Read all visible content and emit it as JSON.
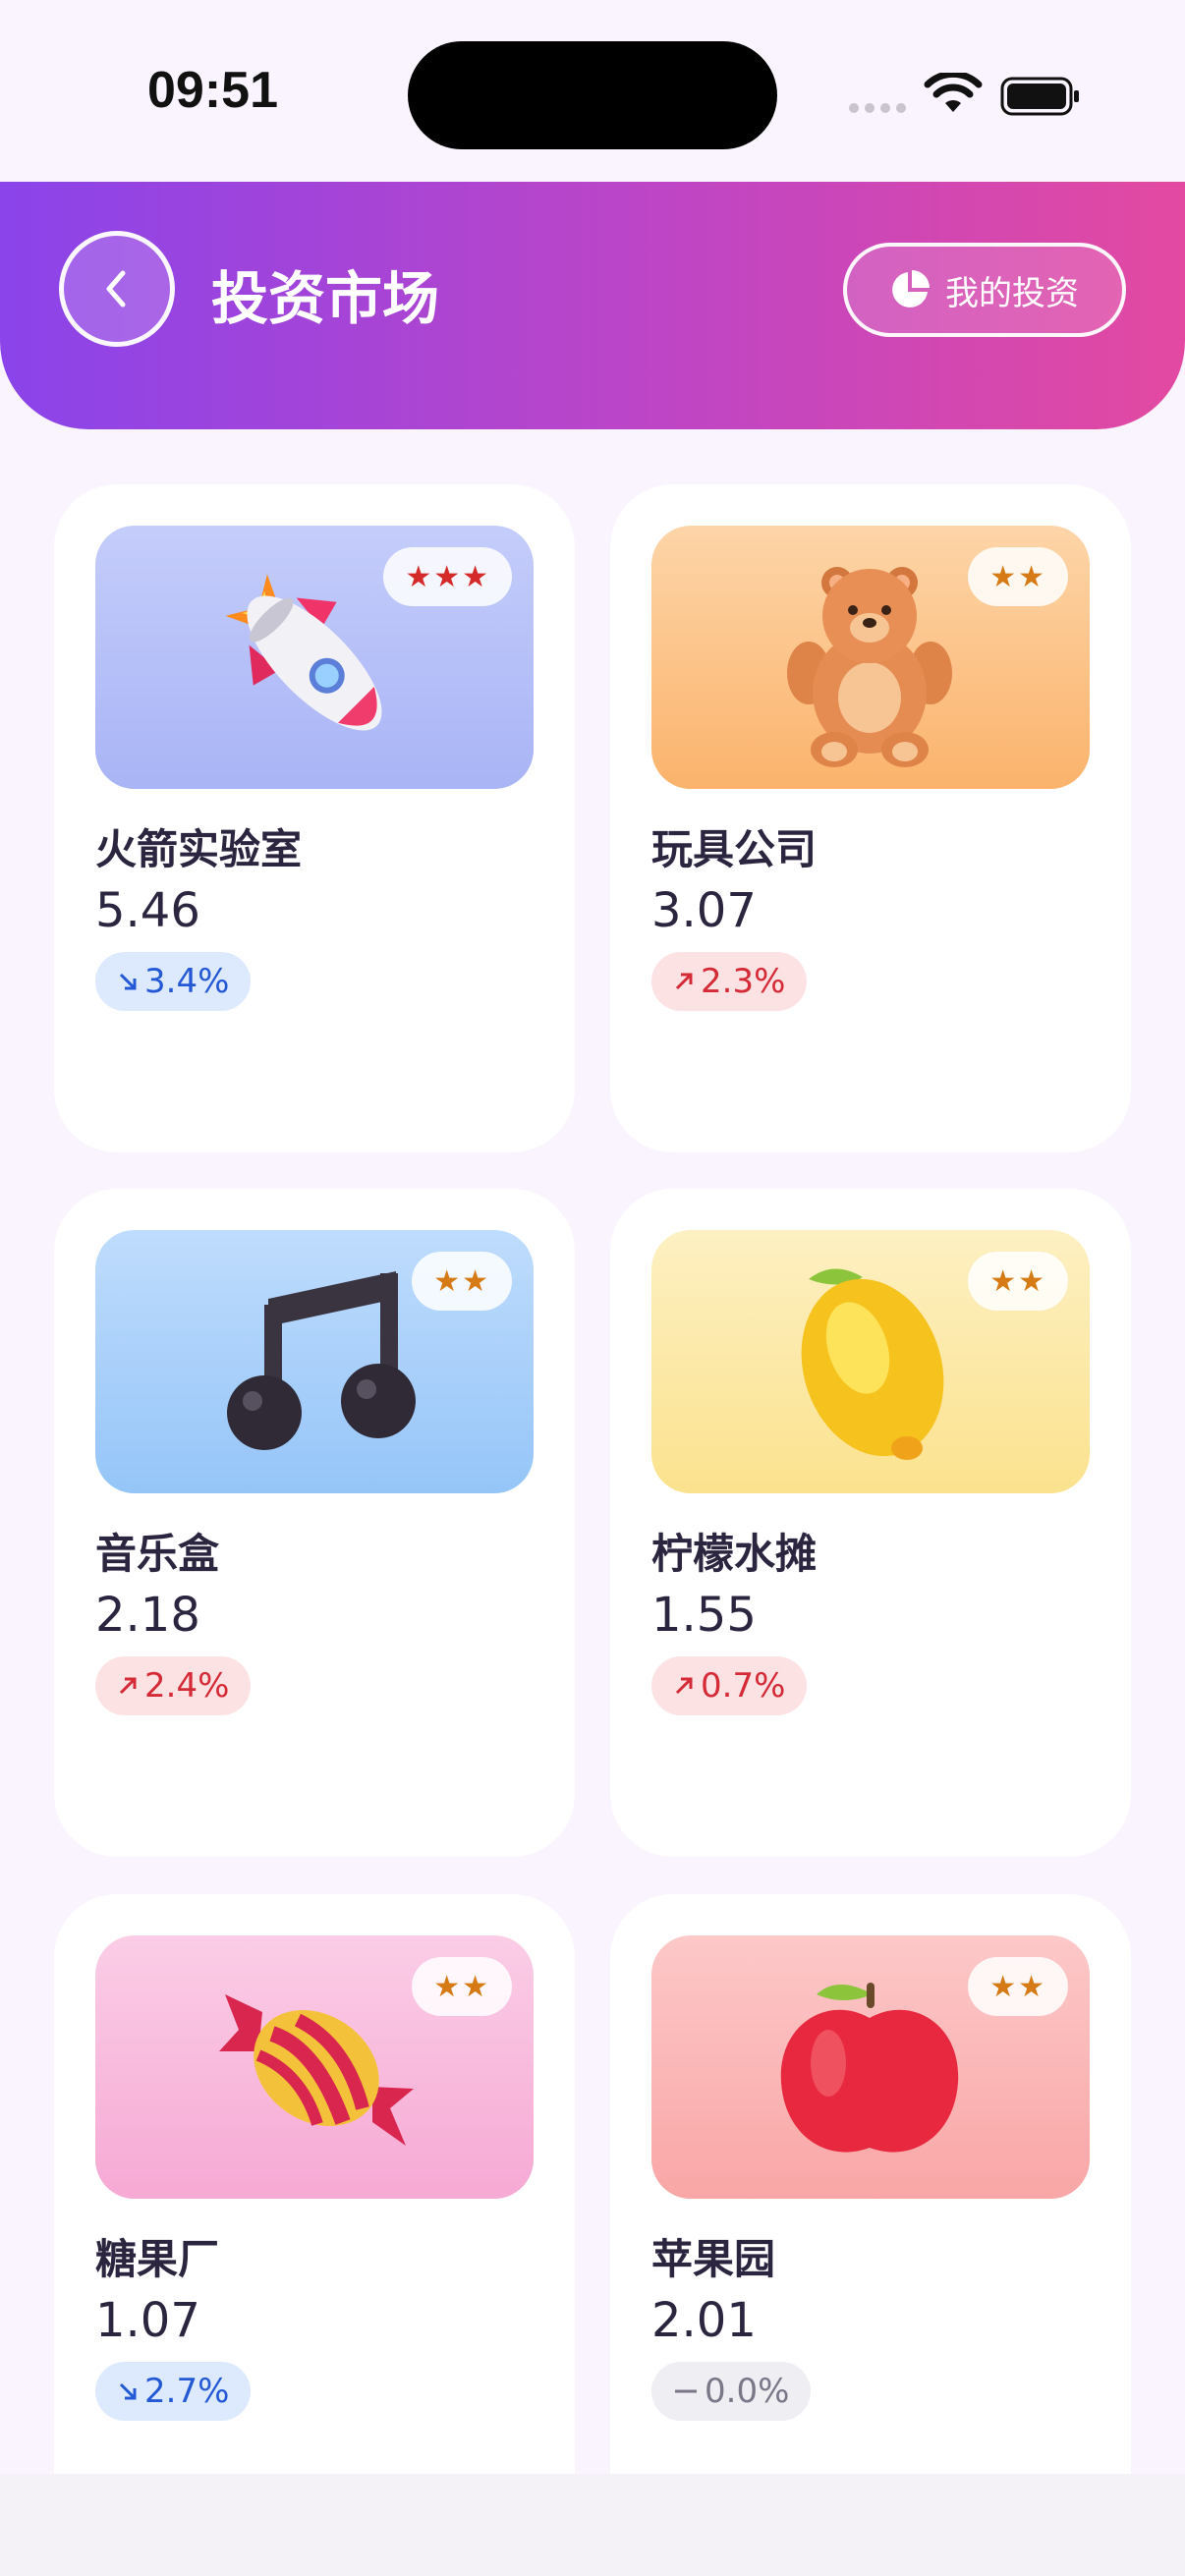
{
  "status_bar": {
    "time": "09:51"
  },
  "header": {
    "title": "投资市场",
    "my_investment_label": "我的投资"
  },
  "cards": [
    {
      "name": "火箭实验室",
      "price": "5.46",
      "stars": "★★★",
      "change": "3.4%",
      "trend": "down",
      "icon": "rocket-icon"
    },
    {
      "name": "玩具公司",
      "price": "3.07",
      "stars": "★★",
      "change": "2.3%",
      "trend": "up",
      "icon": "teddy-bear-icon"
    },
    {
      "name": "音乐盒",
      "price": "2.18",
      "stars": "★★",
      "change": "2.4%",
      "trend": "up",
      "icon": "music-note-icon"
    },
    {
      "name": "柠檬水摊",
      "price": "1.55",
      "stars": "★★",
      "change": "0.7%",
      "trend": "up",
      "icon": "lemon-icon"
    },
    {
      "name": "糖果厂",
      "price": "1.07",
      "stars": "★★",
      "change": "2.7%",
      "trend": "down",
      "icon": "candy-icon"
    },
    {
      "name": "苹果园",
      "price": "2.01",
      "stars": "★★",
      "change": "0.0%",
      "trend": "flat",
      "icon": "apple-icon"
    }
  ],
  "colors": {
    "header_gradient": [
      "#8a44ea",
      "#bd45c6",
      "#e349a1"
    ],
    "down": "#2459d6",
    "up": "#d52b36",
    "flat": "#7b7789"
  }
}
